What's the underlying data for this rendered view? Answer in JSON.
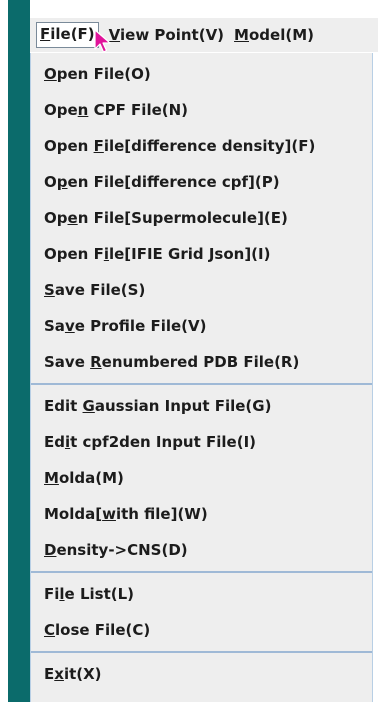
{
  "colors": {
    "accent": "#0b6b6b",
    "separator": "#9fb9d6",
    "cursor": "#e0139a"
  },
  "menubar": [
    {
      "text": "File(F)",
      "mnemonic_index": 0,
      "active": true
    },
    {
      "text": "View Point(V)",
      "mnemonic_index": 0,
      "active": false
    },
    {
      "text": "Model(M)",
      "mnemonic_index": 0,
      "active": false
    }
  ],
  "menu": {
    "groups": [
      [
        {
          "text": "Open File(O)",
          "mnemonic_index": 0
        },
        {
          "text": "Open CPF File(N)",
          "mnemonic_index": 3
        },
        {
          "text": "Open File[difference density](F)",
          "mnemonic_index": 5
        },
        {
          "text": "Open File[difference cpf](P)",
          "mnemonic_index": 1
        },
        {
          "text": "Open File[Supermolecule](E)",
          "mnemonic_index": 2
        },
        {
          "text": "Open File[IFIE Grid Json](I)",
          "mnemonic_index": 6
        },
        {
          "text": "Save File(S)",
          "mnemonic_index": 0
        },
        {
          "text": "Save Profile File(V)",
          "mnemonic_index": 2
        },
        {
          "text": "Save Renumbered PDB File(R)",
          "mnemonic_index": 5
        }
      ],
      [
        {
          "text": "Edit Gaussian Input File(G)",
          "mnemonic_index": 5
        },
        {
          "text": "Edit cpf2den Input File(I)",
          "mnemonic_index": 2
        },
        {
          "text": "Molda(M)",
          "mnemonic_index": 0
        },
        {
          "text": "Molda[with file](W)",
          "mnemonic_index": 6
        },
        {
          "text": "Density->CNS(D)",
          "mnemonic_index": 0
        }
      ],
      [
        {
          "text": "File List(L)",
          "mnemonic_index": 2
        },
        {
          "text": "Close File(C)",
          "mnemonic_index": 0
        }
      ],
      [
        {
          "text": "Exit(X)",
          "mnemonic_index": 1
        }
      ]
    ]
  }
}
